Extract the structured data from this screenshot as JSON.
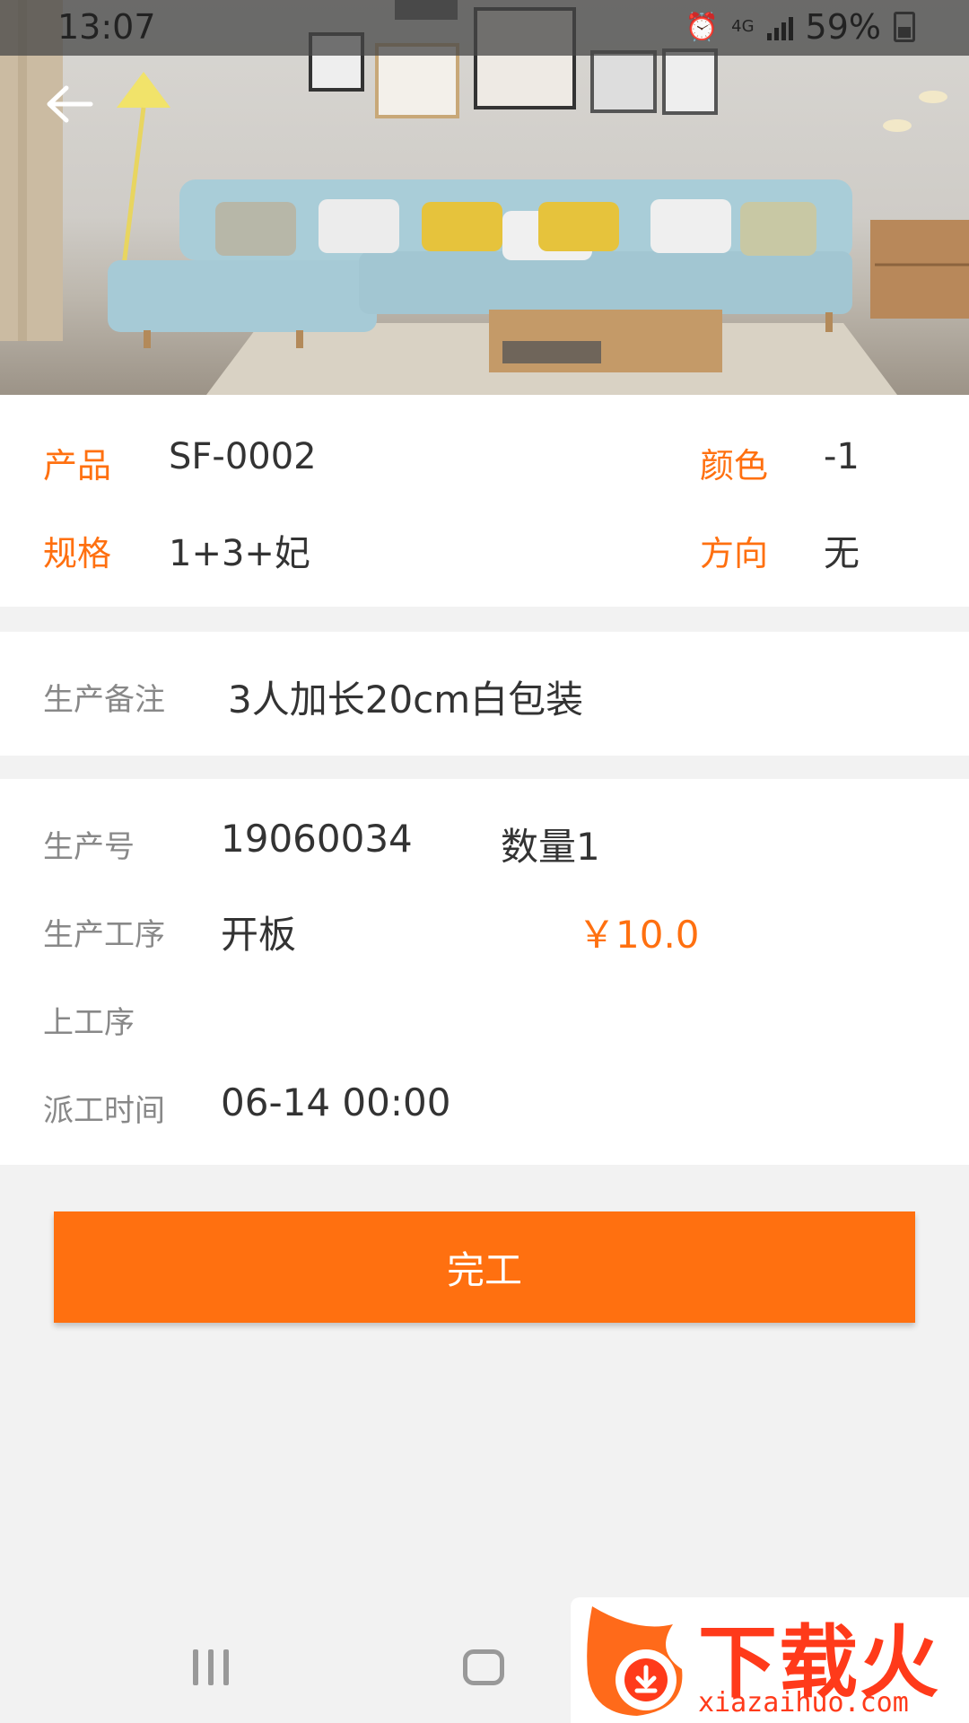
{
  "status_bar": {
    "time": "13:07",
    "network": "4G",
    "battery": "59%"
  },
  "product": {
    "product_label": "产品",
    "product_value": "SF-0002",
    "color_label": "颜色",
    "color_value": "-1",
    "spec_label": "规格",
    "spec_value": "1+3+妃",
    "direction_label": "方向",
    "direction_value": "无"
  },
  "remark": {
    "label": "生产备注",
    "value": "3人加长20cm白包装"
  },
  "production": {
    "number_label": "生产号",
    "number_value": "19060034",
    "quantity": "数量1",
    "process_label": "生产工序",
    "process_value": "开板",
    "price": "￥10.0",
    "prev_process_label": "上工序",
    "prev_process_value": "",
    "dispatch_label": "派工时间",
    "dispatch_value": "06-14 00:00"
  },
  "actions": {
    "complete_label": "完工"
  },
  "watermark": {
    "brand": "下载火",
    "url": "xiazaihuo.com"
  },
  "colors": {
    "accent": "#ff7010",
    "background": "#f2f2f2"
  },
  "icons": [
    "back-arrow-icon",
    "alarm-icon",
    "signal-icon",
    "battery-icon",
    "recent-apps-icon",
    "home-icon"
  ]
}
